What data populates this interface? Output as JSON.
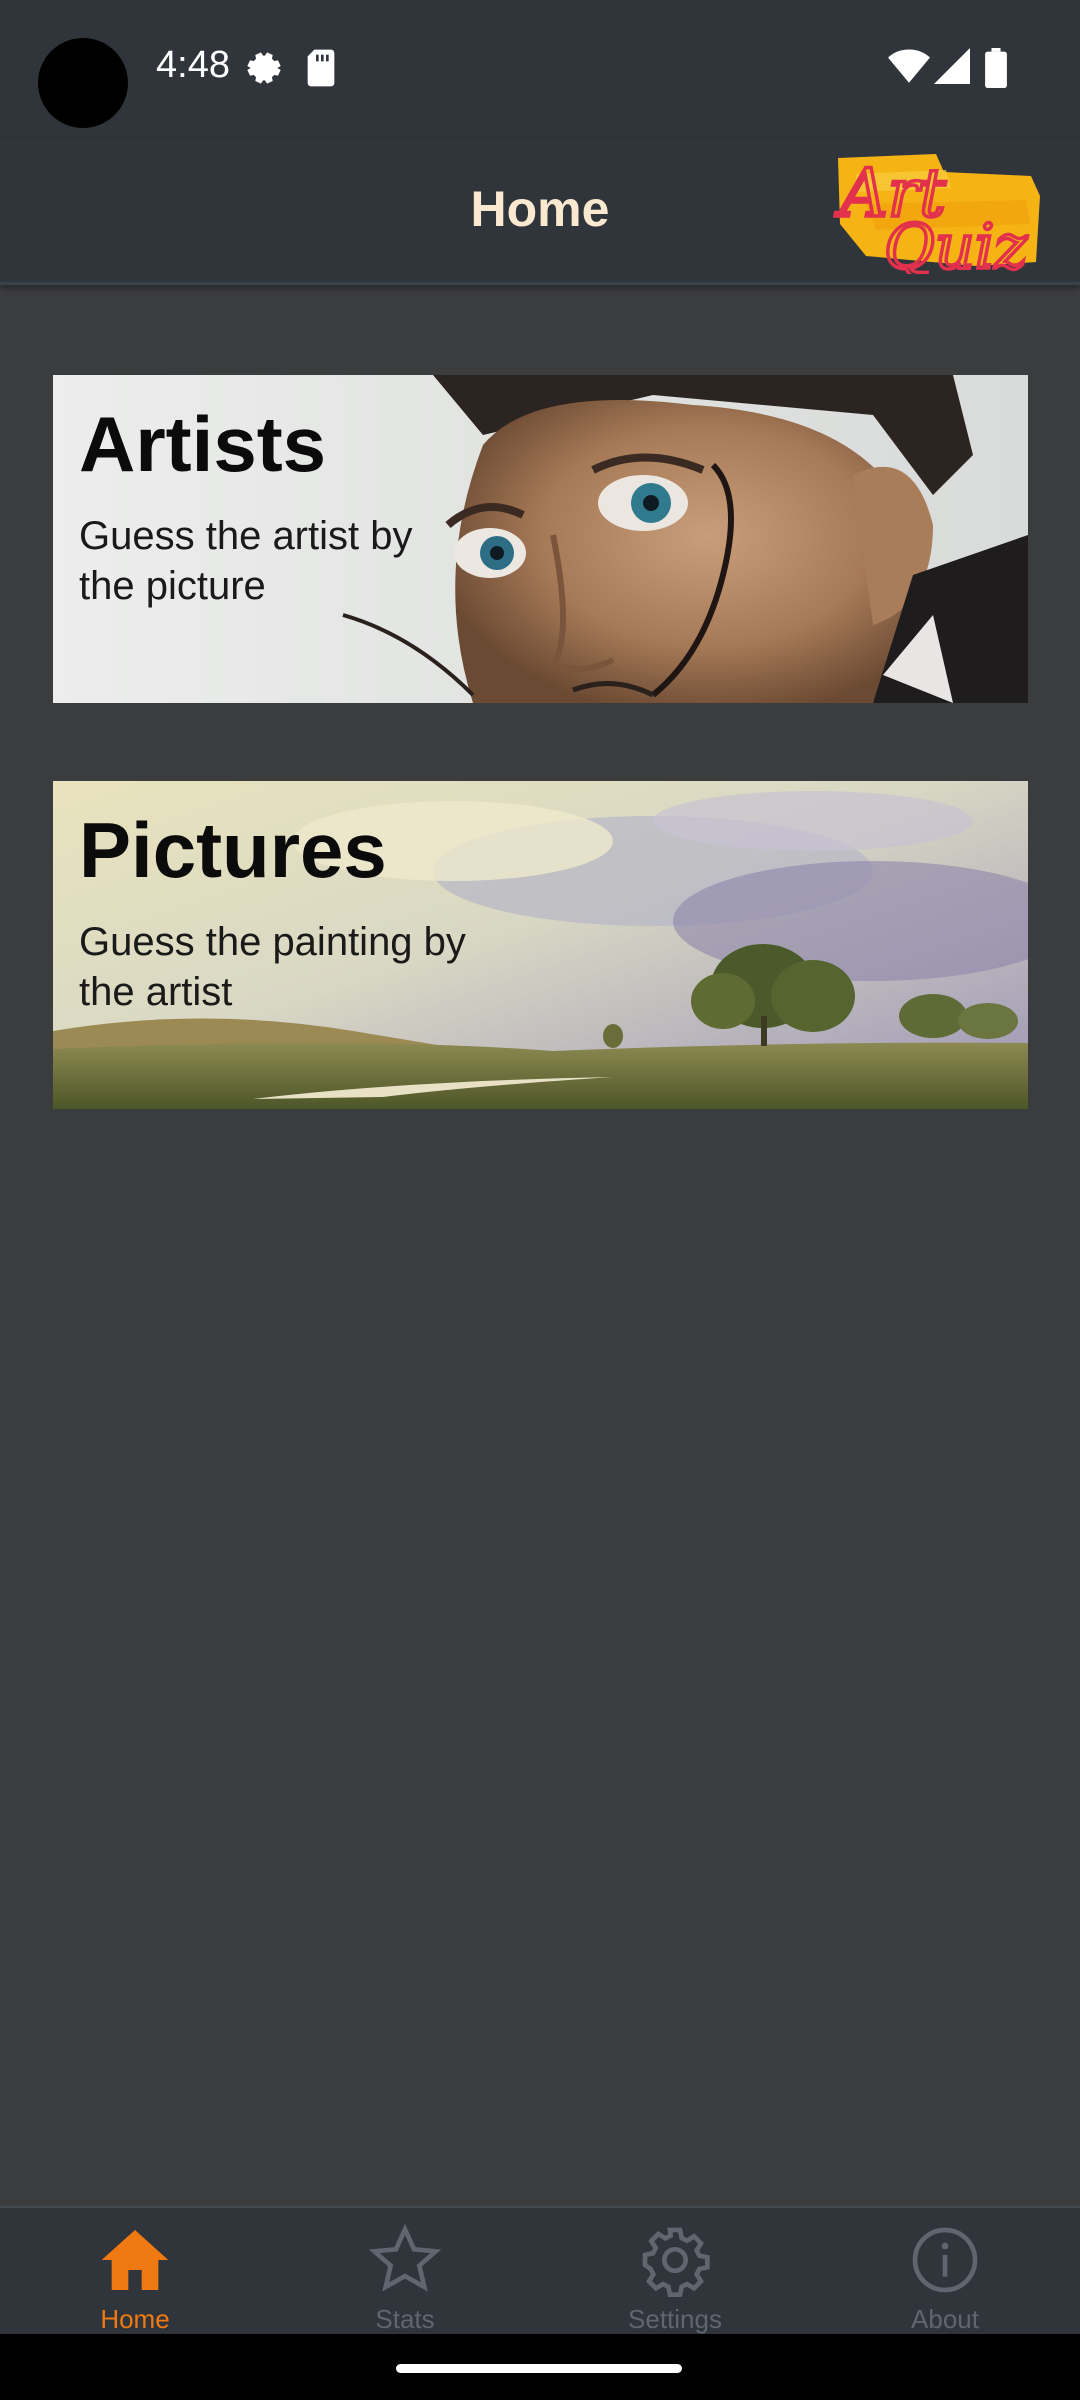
{
  "status_bar": {
    "time": "4:48",
    "icons": [
      "settings-gear-icon",
      "sd-card-icon",
      "wifi-icon",
      "cell-signal-icon",
      "battery-icon"
    ]
  },
  "app_bar": {
    "title": "Home",
    "logo_text": [
      "Art",
      "Quiz"
    ],
    "colors": {
      "background": "#2f353b",
      "title": "#fbe8d0"
    }
  },
  "cards": [
    {
      "title": "Artists",
      "description": "Guess the artist by the picture"
    },
    {
      "title": "Pictures",
      "description": "Guess the painting by the artist"
    }
  ],
  "bottom_nav": {
    "active_color": "#f07a12",
    "inactive_color": "#5f6670",
    "items": [
      {
        "label": "Home",
        "icon": "home-icon",
        "active": true
      },
      {
        "label": "Stats",
        "icon": "star-icon",
        "active": false
      },
      {
        "label": "Settings",
        "icon": "gear-icon",
        "active": false
      },
      {
        "label": "About",
        "icon": "info-icon",
        "active": false
      }
    ]
  }
}
